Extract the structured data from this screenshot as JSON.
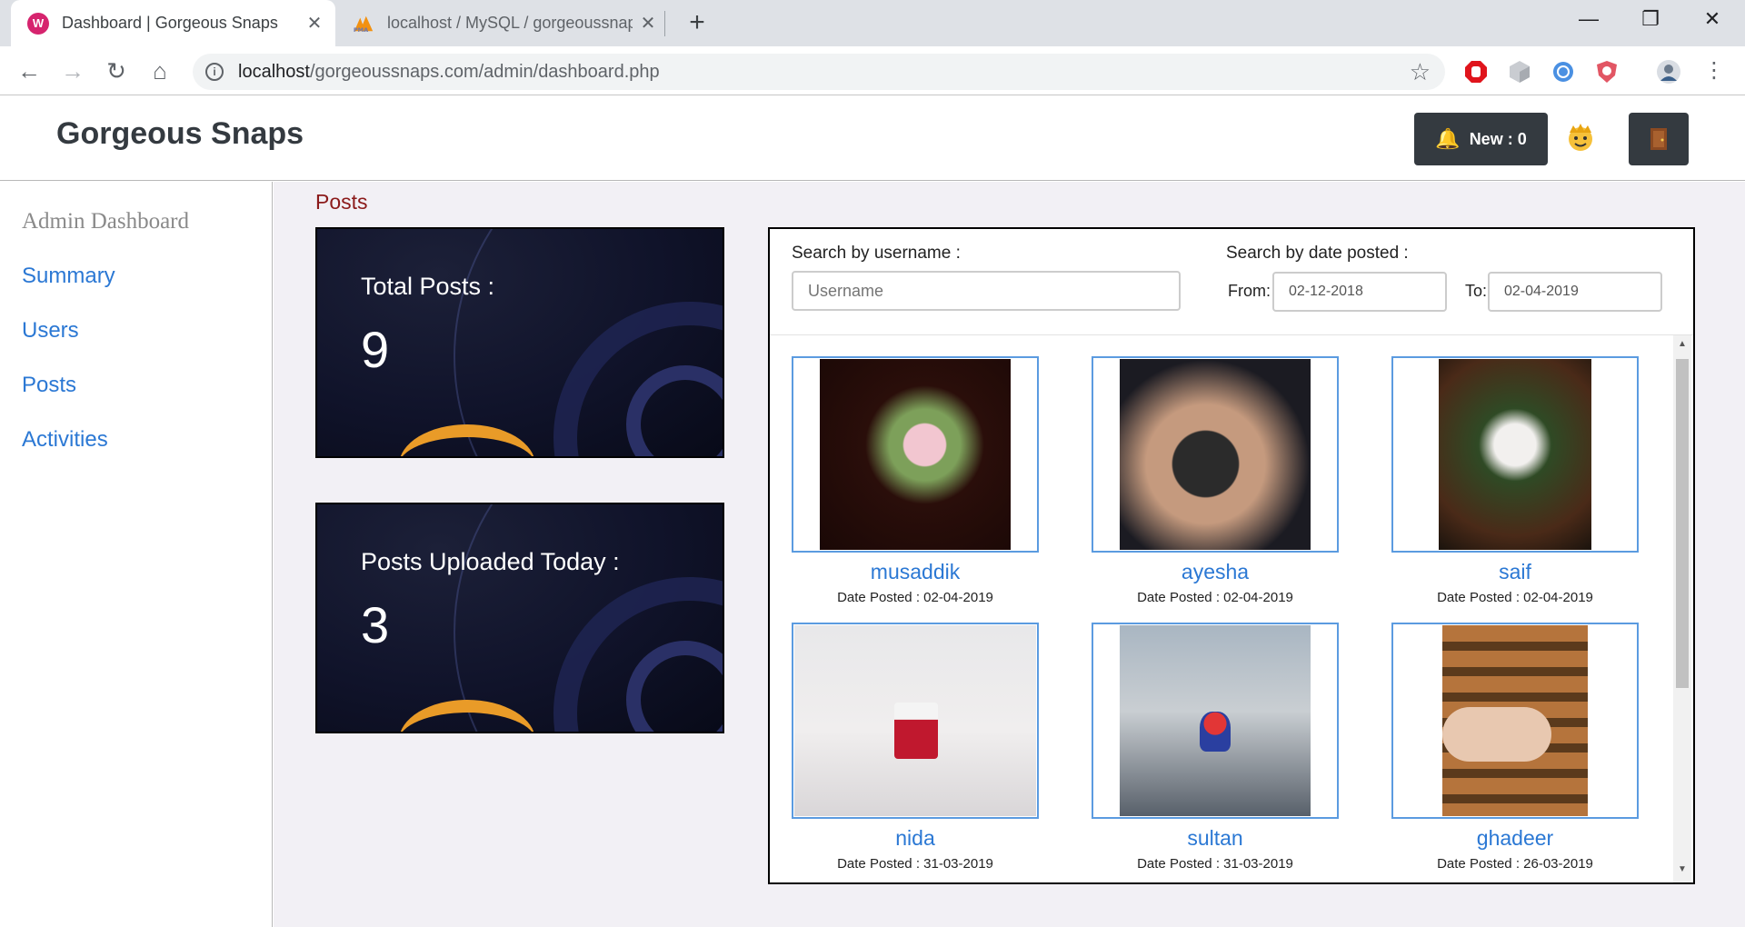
{
  "browser": {
    "tabs": [
      {
        "title": "Dashboard | Gorgeous Snaps",
        "favicon": "wamp-icon",
        "active": true
      },
      {
        "title": "localhost / MySQL / gorgeoussnaps",
        "favicon": "phpmyadmin-icon",
        "active": false
      }
    ],
    "url_host": "localhost",
    "url_path": "/gorgeoussnaps.com/admin/dashboard.php"
  },
  "header": {
    "brand": "Gorgeous Snaps",
    "notifications_label": "New : 0"
  },
  "sidebar": {
    "title": "Admin Dashboard",
    "items": [
      {
        "label": "Summary"
      },
      {
        "label": "Users"
      },
      {
        "label": "Posts"
      },
      {
        "label": "Activities"
      }
    ]
  },
  "main": {
    "section_title": "Posts",
    "stats": [
      {
        "label": "Total Posts :",
        "value": "9"
      },
      {
        "label": "Posts Uploaded Today :",
        "value": "3"
      }
    ],
    "search": {
      "username_label": "Search by username :",
      "username_placeholder": "Username",
      "date_label": "Search by date posted :",
      "from_label": "From:",
      "from_value": "02-12-2018",
      "to_label": "To:",
      "to_value": "02-04-2019"
    },
    "posts": [
      {
        "user": "musaddik",
        "date": "Date Posted : 02-04-2019"
      },
      {
        "user": "ayesha",
        "date": "Date Posted : 02-04-2019"
      },
      {
        "user": "saif",
        "date": "Date Posted : 02-04-2019"
      },
      {
        "user": "nida",
        "date": "Date Posted : 31-03-2019"
      },
      {
        "user": "sultan",
        "date": "Date Posted : 31-03-2019"
      },
      {
        "user": "ghadeer",
        "date": "Date Posted : 26-03-2019"
      }
    ]
  },
  "colors": {
    "accent_link": "#2b78d4",
    "section_title": "#8b1a1a",
    "dark_button": "#343a40",
    "thumb_border": "#5b9be0"
  }
}
